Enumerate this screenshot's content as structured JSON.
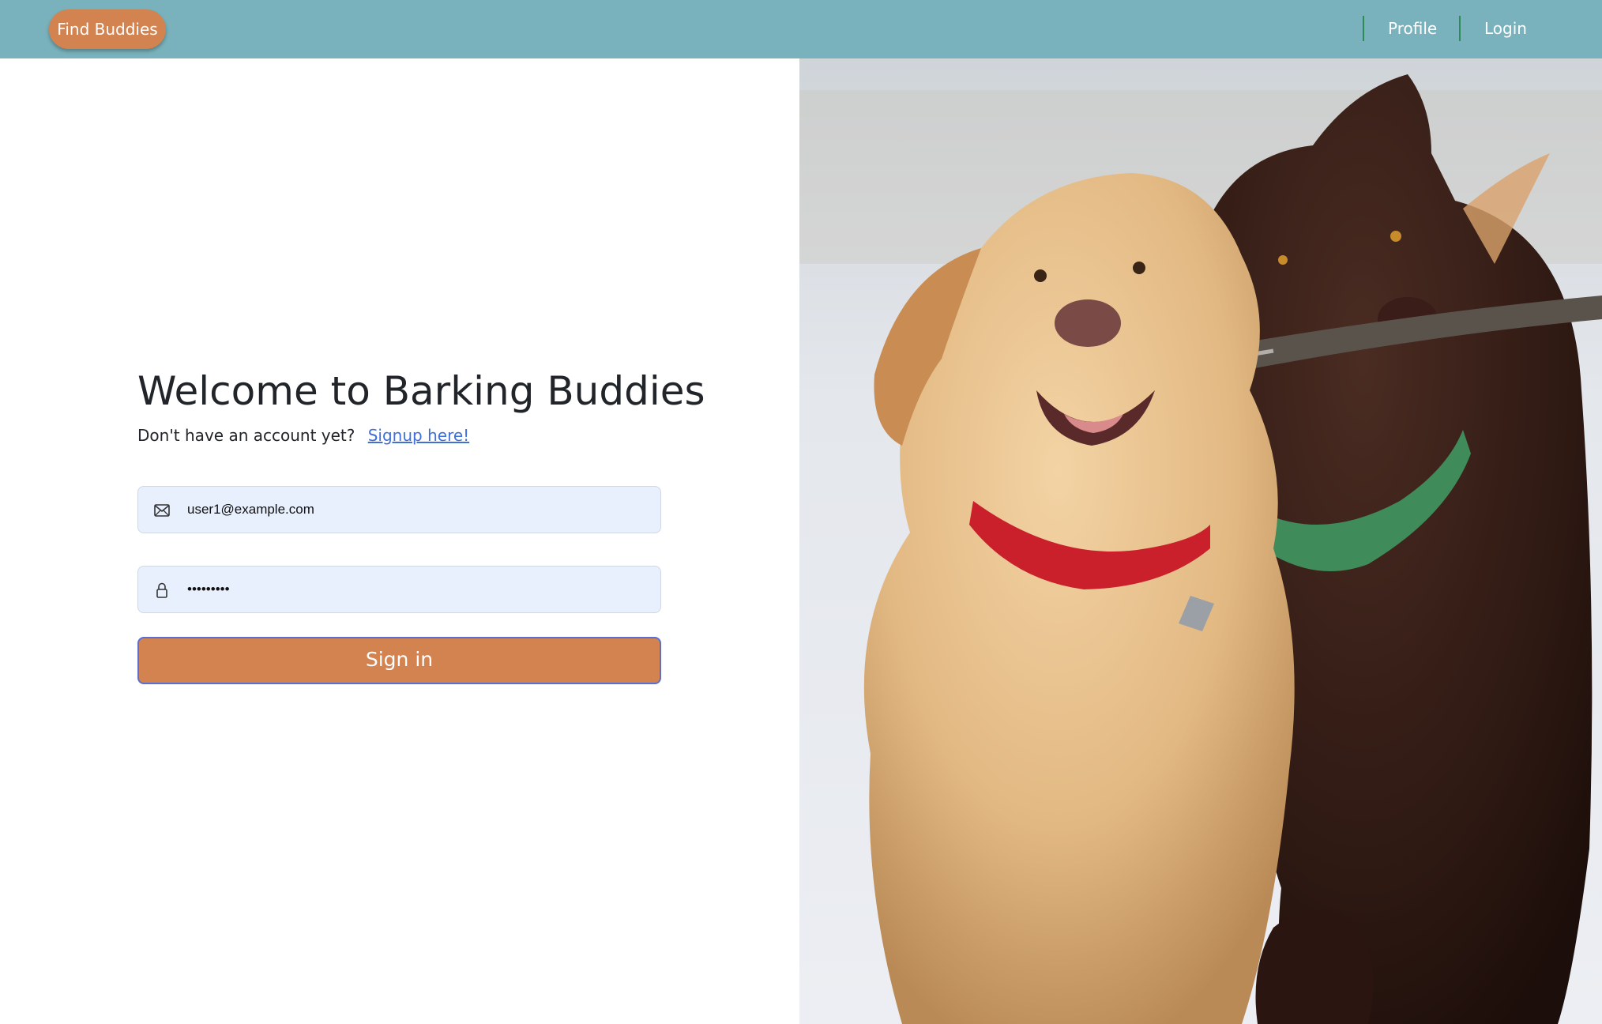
{
  "navbar": {
    "brand_label": "Find Buddies",
    "links": [
      {
        "label": "Profile"
      },
      {
        "label": "Login"
      }
    ],
    "divider_color": "#2e8b57",
    "background_color": "#79b2bc"
  },
  "login": {
    "title": "Welcome to Barking Buddies",
    "signup_prompt": "Don't have an account yet?",
    "signup_link": "Signup here!",
    "email": {
      "value": "user1@example.com",
      "icon": "envelope-icon"
    },
    "password": {
      "value": "password1",
      "icon": "lock-icon"
    },
    "submit_label": "Sign in",
    "accent_color": "#d3834f"
  },
  "hero": {
    "description_icon": "dogs-photo"
  }
}
